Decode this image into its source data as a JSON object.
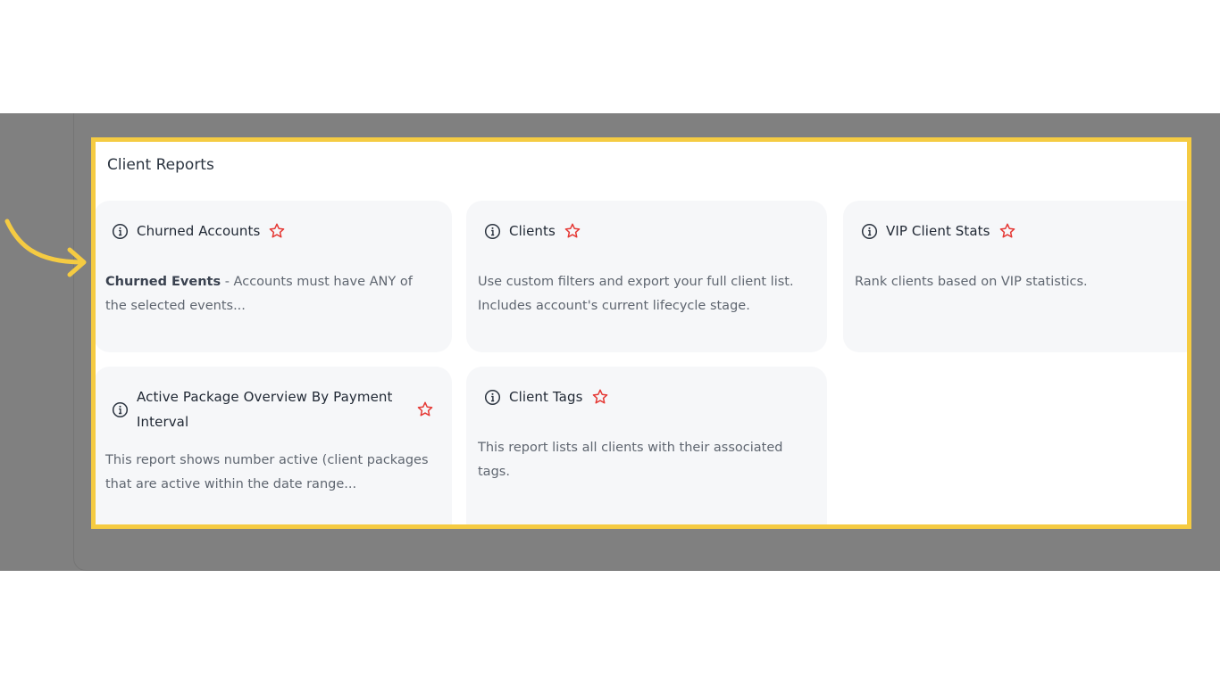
{
  "section": {
    "title": "Client Reports"
  },
  "cards": [
    {
      "title": "Churned Accounts",
      "desc_bold": "Churned Events",
      "desc": " - Accounts must have ANY of the selected events..."
    },
    {
      "title": "Clients",
      "desc": "Use custom filters and export your full client list. Includes account's current lifecycle stage."
    },
    {
      "title": "VIP Client Stats",
      "desc": "Rank clients based on VIP statistics."
    },
    {
      "title": "Active Package Overview By Payment Interval",
      "desc": "This report shows number active (client packages that are active within the date range..."
    },
    {
      "title": "Client Tags",
      "desc": "This report lists all clients with their associated tags."
    }
  ],
  "icons": {
    "info": "info-icon",
    "favorite": "star-outline-icon",
    "pointer": "curved-arrow-icon"
  },
  "colors": {
    "highlight": "#f5cb42",
    "star": "#e53935",
    "overlay": "#808080",
    "card_bg": "#f6f7f9"
  }
}
